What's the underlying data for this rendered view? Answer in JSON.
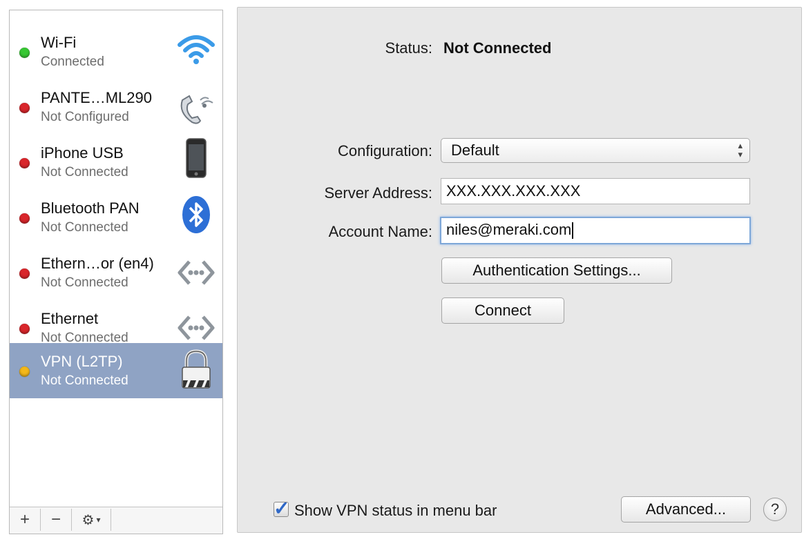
{
  "sidebar": {
    "services": [
      {
        "name": "Wi-Fi",
        "status": "Connected",
        "dot": "green",
        "icon": "wifi-icon"
      },
      {
        "name": "PANTE…ML290",
        "status": "Not Configured",
        "dot": "red",
        "icon": "modem-phone-icon"
      },
      {
        "name": "iPhone USB",
        "status": "Not Connected",
        "dot": "red",
        "icon": "iphone-icon"
      },
      {
        "name": "Bluetooth PAN",
        "status": "Not Connected",
        "dot": "red",
        "icon": "bluetooth-icon"
      },
      {
        "name": "Ethern…or (en4)",
        "status": "Not Connected",
        "dot": "red",
        "icon": "ethernet-icon"
      },
      {
        "name": "Ethernet",
        "status": "Not Connected",
        "dot": "red",
        "icon": "ethernet-icon"
      },
      {
        "name": "VPN (L2TP)",
        "status": "Not Connected",
        "dot": "yellow",
        "icon": "vpn-lock-icon"
      }
    ],
    "toolbar": {
      "add": "+",
      "remove": "−",
      "gear": "⚙",
      "gear_arrow": "▾"
    }
  },
  "main": {
    "status_label": "Status:",
    "status_value": "Not Connected",
    "configuration_label": "Configuration:",
    "configuration_value": "Default",
    "server_label": "Server Address:",
    "server_value": "XXX.XXX.XXX.XXX",
    "account_label": "Account Name:",
    "account_value": "niles@meraki.com",
    "auth_button": "Authentication Settings...",
    "connect_button": "Connect",
    "show_status_label": "Show VPN status in menu bar",
    "show_status_checked": true,
    "advanced_button": "Advanced...",
    "help_button": "?"
  },
  "colors": {
    "selection": "#8fa3c4",
    "pane_bg": "#e8e8e8",
    "dot_green": "#37c733",
    "dot_red": "#d9262b",
    "dot_yellow": "#f4b81a"
  }
}
